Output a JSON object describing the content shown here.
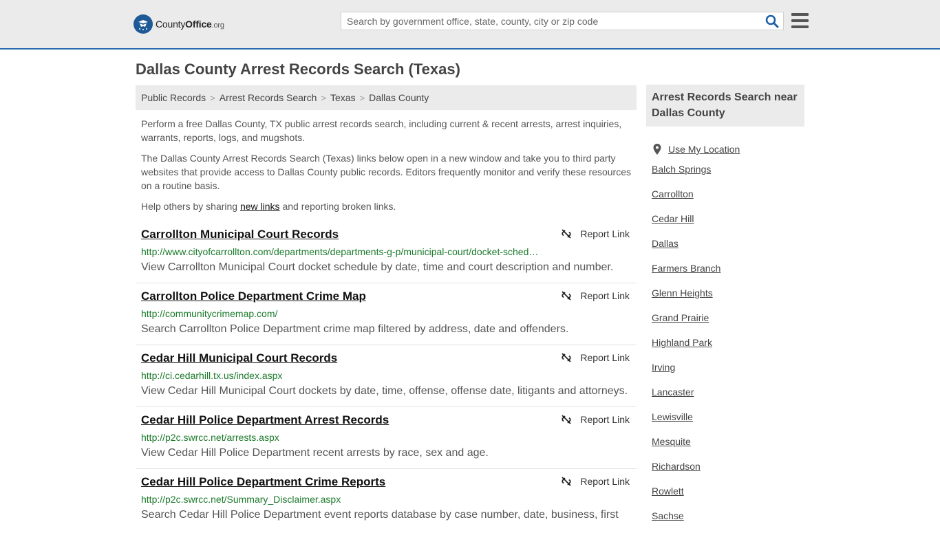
{
  "header": {
    "logo": {
      "name_bold": "County",
      "name_rest": "Office",
      "tld": ".org"
    },
    "search": {
      "placeholder": "Search by government office, state, county, city or zip code",
      "value": ""
    }
  },
  "page_title": "Dallas County Arrest Records Search (Texas)",
  "breadcrumb": [
    "Public Records",
    "Arrest Records Search",
    "Texas",
    "Dallas County"
  ],
  "intro": {
    "p1": "Perform a free Dallas County, TX public arrest records search, including current & recent arrests, arrest inquiries, warrants, reports, logs, and mugshots.",
    "p2": "The Dallas County Arrest Records Search (Texas) links below open in a new window and take you to third party websites that provide access to Dallas County public records. Editors frequently monitor and verify these resources on a routine basis.",
    "p3_before": "Help others by sharing ",
    "p3_link": "new links",
    "p3_after": " and reporting broken links."
  },
  "report_label": "Report Link",
  "results": [
    {
      "title": "Carrollton Municipal Court Records",
      "url": "http://www.cityofcarrollton.com/departments/departments-g-p/municipal-court/docket-sched…",
      "desc": "View Carrollton Municipal Court docket schedule by date, time and court description and number."
    },
    {
      "title": "Carrollton Police Department Crime Map",
      "url": "http://communitycrimemap.com/",
      "desc": "Search Carrollton Police Department crime map filtered by address, date and offenders."
    },
    {
      "title": "Cedar Hill Municipal Court Records",
      "url": "http://ci.cedarhill.tx.us/index.aspx",
      "desc": "View Cedar Hill Municipal Court dockets by date, time, offense, offense date, litigants and attorneys."
    },
    {
      "title": "Cedar Hill Police Department Arrest Records",
      "url": "http://p2c.swrcc.net/arrests.aspx",
      "desc": "View Cedar Hill Police Department recent arrests by race, sex and age."
    },
    {
      "title": "Cedar Hill Police Department Crime Reports",
      "url": "http://p2c.swrcc.net/Summary_Disclaimer.aspx",
      "desc": "Search Cedar Hill Police Department event reports database by case number, date, business, first"
    }
  ],
  "sidebar": {
    "heading": "Arrest Records Search near Dallas County",
    "use_location": "Use My Location",
    "cities": [
      "Balch Springs",
      "Carrollton",
      "Cedar Hill",
      "Dallas",
      "Farmers Branch",
      "Glenn Heights",
      "Grand Prairie",
      "Highland Park",
      "Irving",
      "Lancaster",
      "Lewisville",
      "Mesquite",
      "Richardson",
      "Rowlett",
      "Sachse"
    ]
  },
  "colors": {
    "accent": "#2b6cb0",
    "url_green": "#1a7a2a",
    "panel_gray": "#ebebeb"
  }
}
